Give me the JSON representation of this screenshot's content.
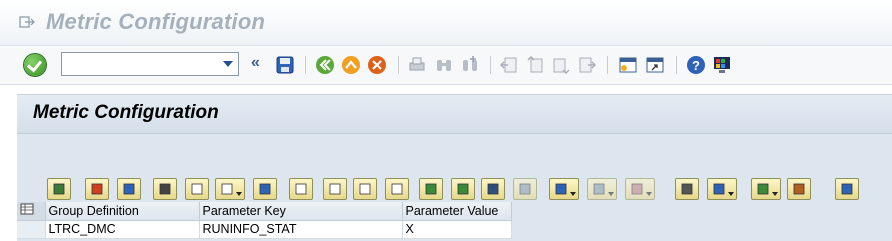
{
  "window": {
    "title": "Metric Configuration"
  },
  "toolbar": {
    "command_field_value": "",
    "back_chevrons": "«",
    "icons": [
      "ok-icon",
      "save-icon",
      "back-icon",
      "exit-icon",
      "cancel-icon",
      "print-icon",
      "find-icon",
      "find-next-icon",
      "first-page-icon",
      "previous-page-icon",
      "next-page-icon",
      "last-page-icon",
      "create-session-icon",
      "shortcut-icon",
      "help-icon",
      "customize-layout-icon"
    ]
  },
  "panel": {
    "title": "Metric Configuration"
  },
  "alv_toolbar": {
    "buttons": [
      "details-icon",
      "check-icon",
      "refresh-icon",
      "cut-icon",
      "copy-icon",
      "paste-icon",
      "undo-icon",
      "append-row-icon",
      "insert-row-icon",
      "delete-row-icon",
      "duplicate-row-icon",
      "sort-ascending-icon",
      "sort-descending-icon",
      "find-icon",
      "find-next-icon",
      "filter-icon",
      "total-icon",
      "subtotal-icon",
      "print-icon",
      "views-icon",
      "export-icon",
      "layout-icon",
      "info-icon"
    ]
  },
  "table": {
    "columns": [
      "Group Definition",
      "Parameter Key",
      "Parameter Value"
    ],
    "rows": [
      [
        "LTRC_DMC",
        "RUNINFO_STAT",
        "X"
      ]
    ]
  },
  "colors": {
    "title_gray": "#a6b0bb",
    "panel_bg": "#dde6ef",
    "accent_blue": "#3a5f95"
  }
}
